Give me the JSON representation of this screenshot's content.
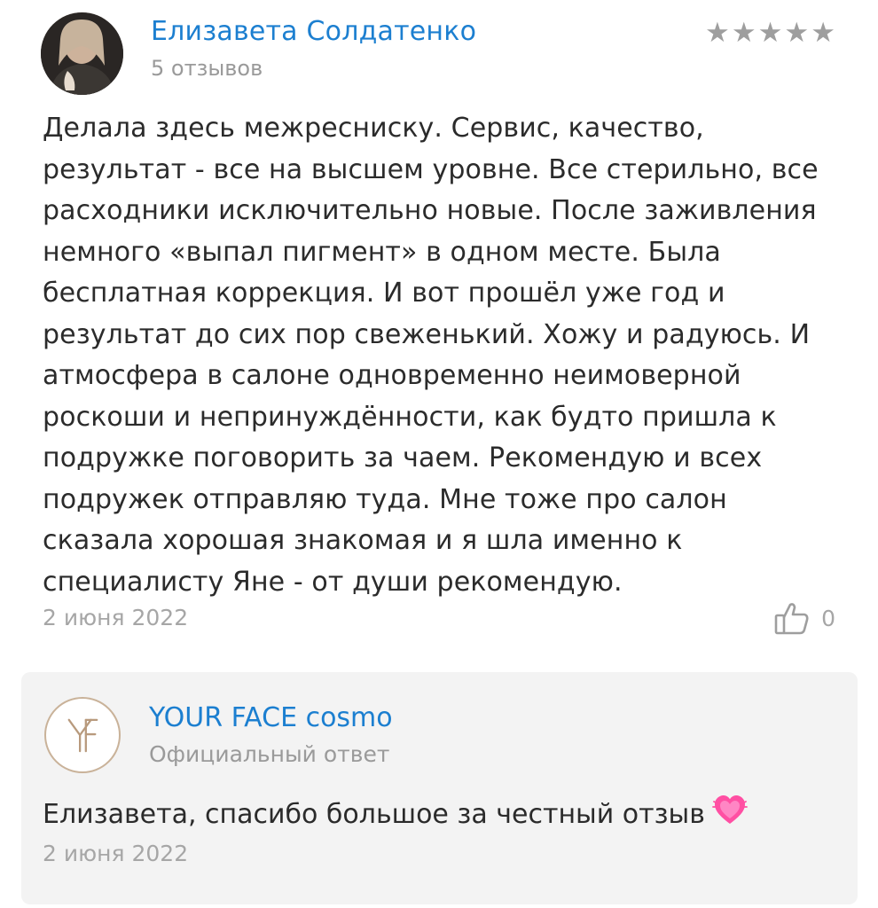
{
  "review": {
    "author_name": "Елизавета Солдатенко",
    "review_count": "5 отзывов",
    "rating": 5,
    "stars": [
      "★",
      "★",
      "★",
      "★",
      "★"
    ],
    "text": "Делала здесь межресниску. Сервис, качество, результат - все на высшем уровне. Все стерильно, все расходники исключительно новые. После заживления немного «выпал пигмент» в одном месте. Была бесплатная коррекция. И вот прошёл уже год и результат до сих пор свеженький. Хожу и радуюсь. И атмосфера в салоне одновременно неимоверной роскоши и непринуждённости, как будто пришла к подружке поговорить за чаем. Рекомендую и всех подружек отправляю туда. Мне тоже про салон сказала хорошая знакомая и я шла именно к специалисту Яне - от души рекомендую.",
    "date": "2 июня 2022",
    "likes": "0",
    "icons": {
      "like": "thumbs-up-icon",
      "avatar": "user-avatar"
    }
  },
  "reply": {
    "author_name": "YOUR FACE cosmo",
    "label": "Официальный ответ",
    "text": "Елизавета, спасибо большое за честный отзыв",
    "emoji": "heart-icon",
    "date": "2 июня 2022",
    "logo": "salon-logo"
  },
  "colors": {
    "link": "#1c7fd0",
    "text": "#2b2b2b",
    "muted": "#a6a6a6",
    "star": "#9e9e9e",
    "card_bg": "#f3f3f3",
    "heart": "#ff4fa3"
  }
}
